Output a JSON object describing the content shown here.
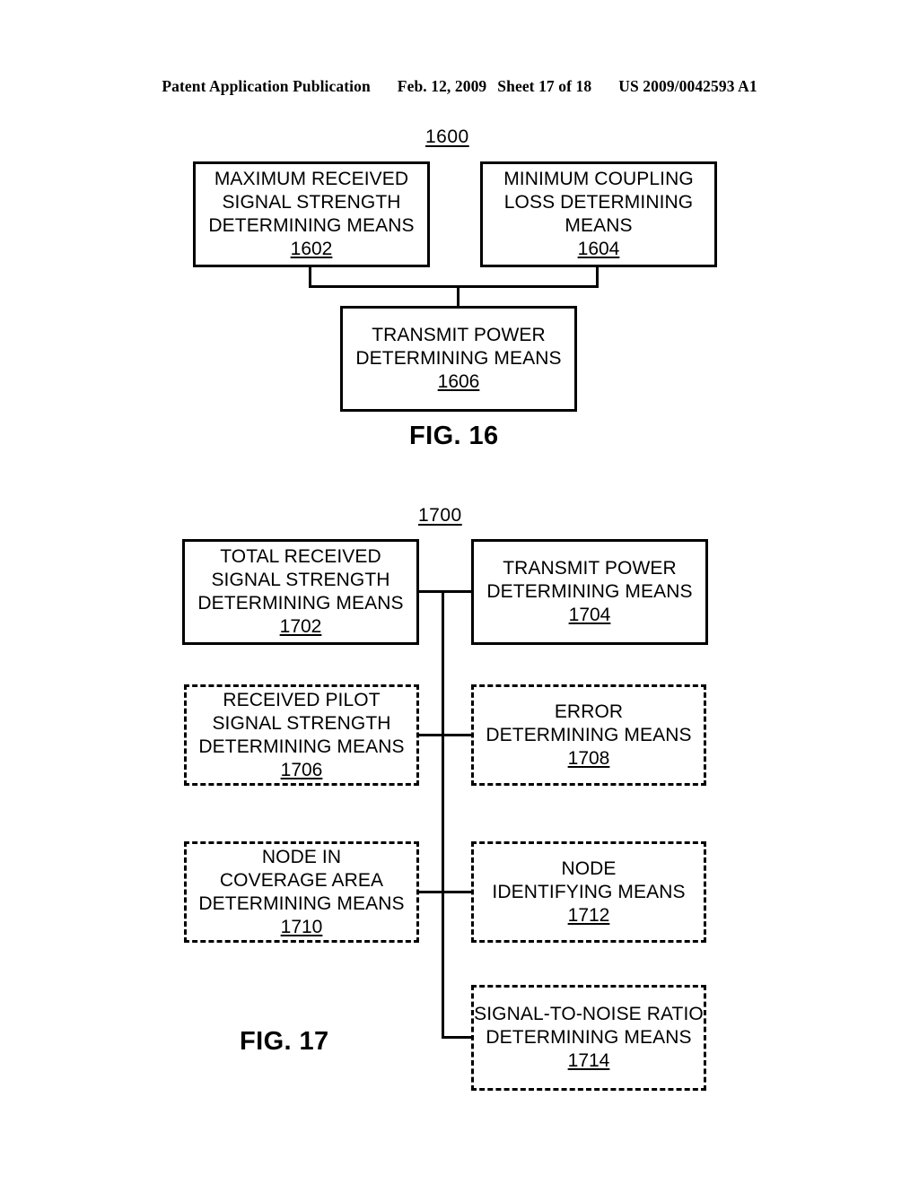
{
  "header": {
    "publication": "Patent Application Publication",
    "date": "Feb. 12, 2009",
    "sheet": "Sheet 17 of 18",
    "patent_number": "US 2009/0042593 A1"
  },
  "figures": [
    {
      "caption": "FIG. 16",
      "ref": "1600",
      "boxes": [
        {
          "ref": "1602",
          "lines": [
            "MAXIMUM RECEIVED",
            "SIGNAL STRENGTH",
            "DETERMINING MEANS"
          ],
          "style": "solid"
        },
        {
          "ref": "1604",
          "lines": [
            "MINIMUM COUPLING",
            "LOSS DETERMINING",
            "MEANS"
          ],
          "style": "solid"
        },
        {
          "ref": "1606",
          "lines": [
            "TRANSMIT POWER",
            "DETERMINING MEANS"
          ],
          "style": "solid"
        }
      ]
    },
    {
      "caption": "FIG. 17",
      "ref": "1700",
      "boxes": [
        {
          "ref": "1702",
          "lines": [
            "TOTAL RECEIVED",
            "SIGNAL STRENGTH",
            "DETERMINING MEANS"
          ],
          "style": "solid"
        },
        {
          "ref": "1704",
          "lines": [
            "TRANSMIT POWER",
            "DETERMINING MEANS"
          ],
          "style": "solid"
        },
        {
          "ref": "1706",
          "lines": [
            "RECEIVED PILOT",
            "SIGNAL STRENGTH",
            "DETERMINING MEANS"
          ],
          "style": "dashed"
        },
        {
          "ref": "1708",
          "lines": [
            "ERROR",
            "DETERMINING MEANS"
          ],
          "style": "dashed"
        },
        {
          "ref": "1710",
          "lines": [
            "NODE IN",
            "COVERAGE AREA",
            "DETERMINING MEANS"
          ],
          "style": "dashed"
        },
        {
          "ref": "1712",
          "lines": [
            "NODE",
            "IDENTIFYING MEANS"
          ],
          "style": "dashed"
        },
        {
          "ref": "1714",
          "lines": [
            "SIGNAL-TO-NOISE RATIO",
            "DETERMINING MEANS"
          ],
          "style": "dashed"
        }
      ]
    }
  ]
}
